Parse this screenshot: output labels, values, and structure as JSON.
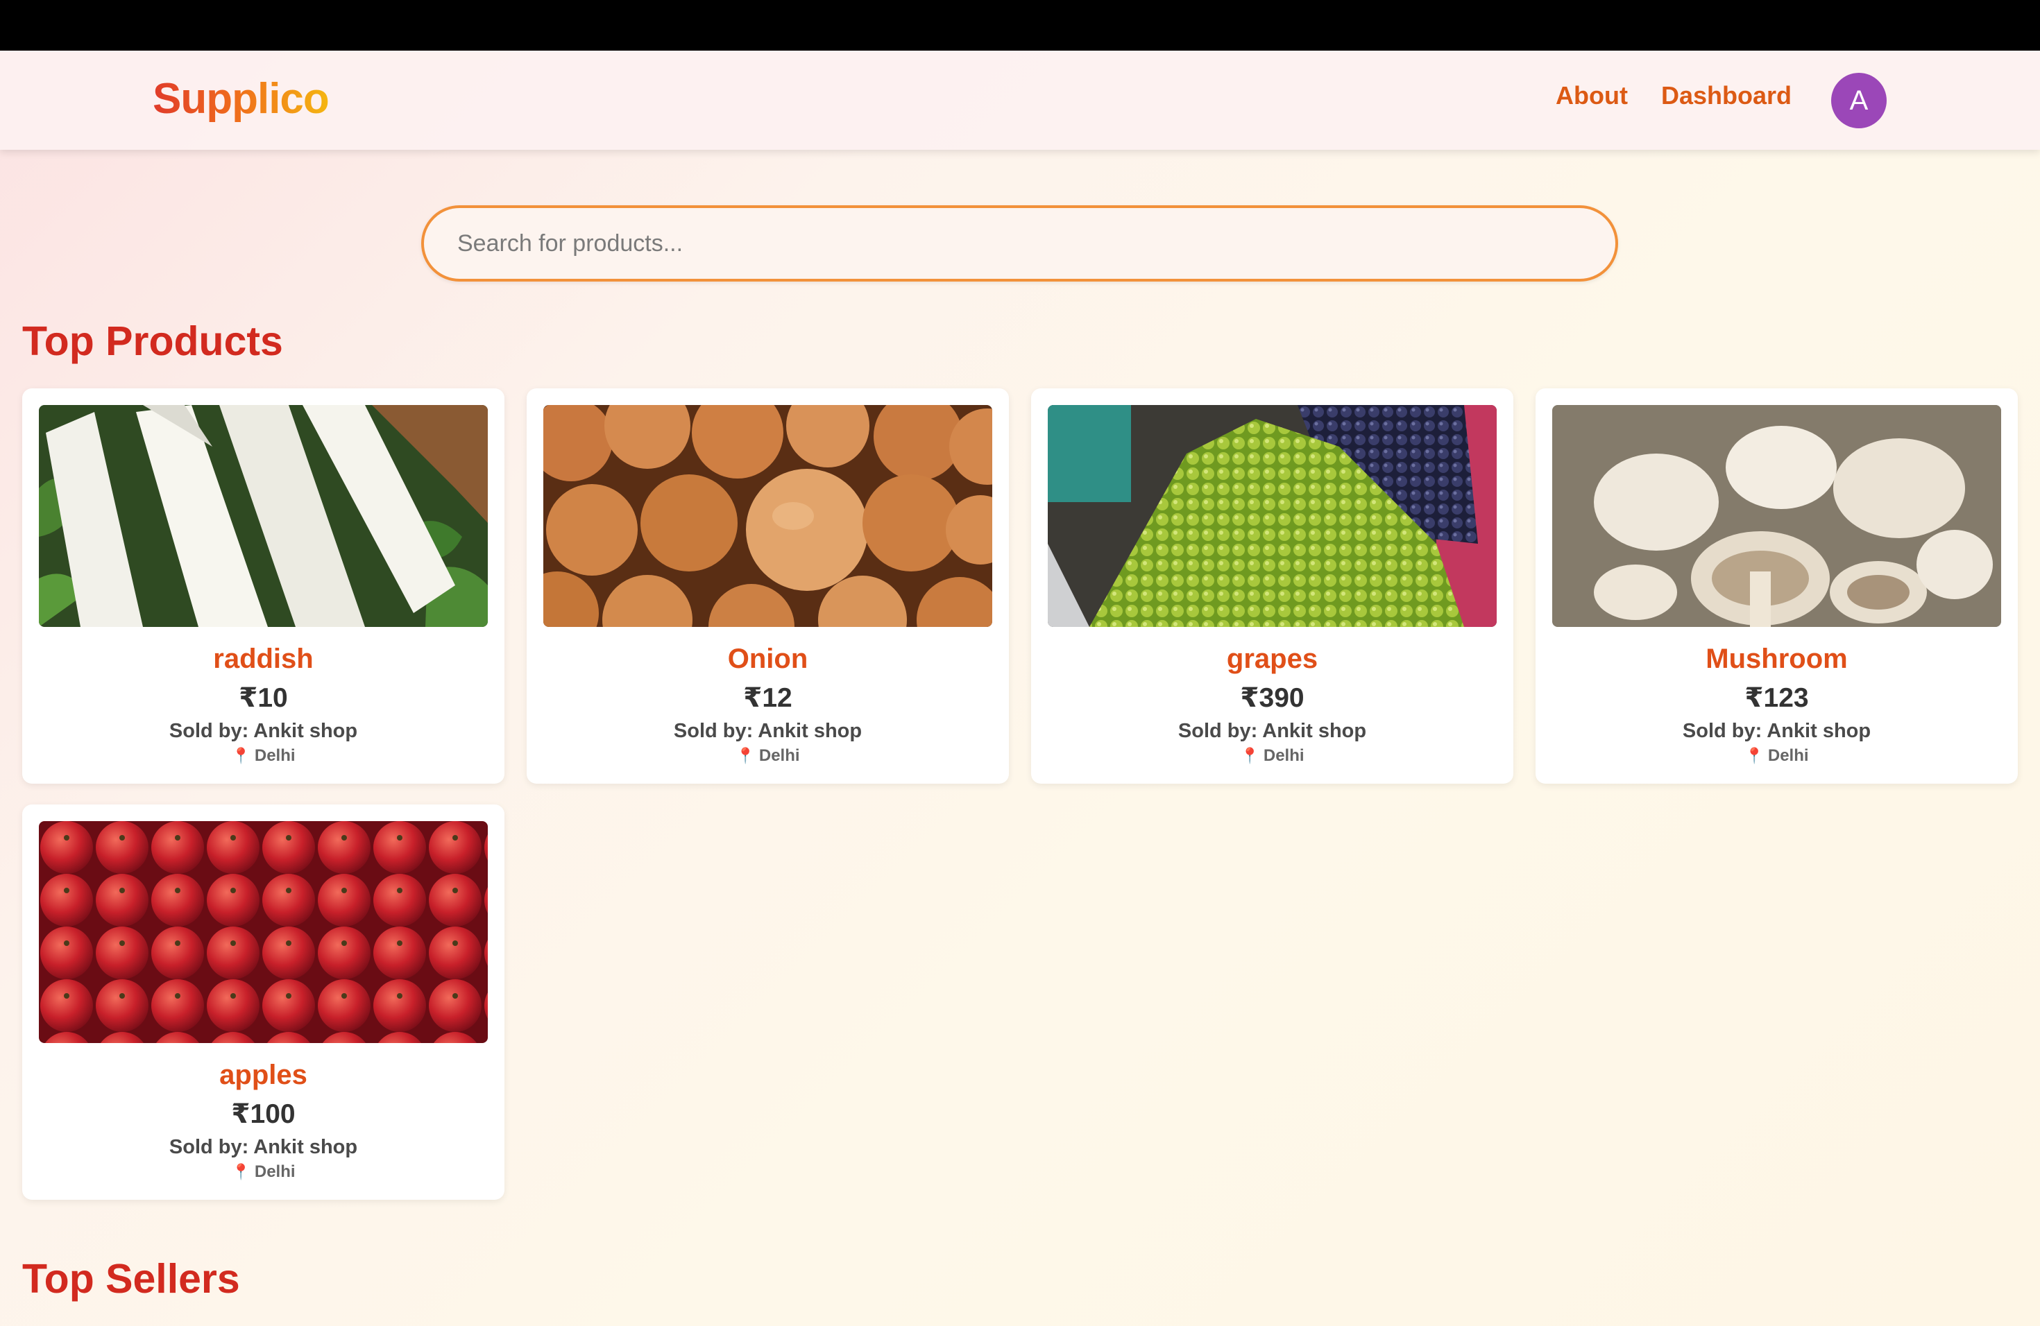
{
  "app": {
    "logo": "Supplico"
  },
  "nav": {
    "about": "About",
    "dashboard": "Dashboard",
    "avatar_initial": "A"
  },
  "search": {
    "placeholder": "Search for products..."
  },
  "sections": {
    "top_products": "Top Products",
    "top_sellers": "Top Sellers"
  },
  "products": [
    {
      "name": "raddish",
      "price": "₹10",
      "seller": "Sold by: Ankit shop",
      "location": "Delhi",
      "image": "radish"
    },
    {
      "name": "Onion",
      "price": "₹12",
      "seller": "Sold by: Ankit shop",
      "location": "Delhi",
      "image": "onion"
    },
    {
      "name": "grapes",
      "price": "₹390",
      "seller": "Sold by: Ankit shop",
      "location": "Delhi",
      "image": "grapes"
    },
    {
      "name": "Mushroom",
      "price": "₹123",
      "seller": "Sold by: Ankit shop",
      "location": "Delhi",
      "image": "mushroom"
    },
    {
      "name": "apples",
      "price": "₹100",
      "seller": "Sold by: Ankit shop",
      "location": "Delhi",
      "image": "apples"
    }
  ],
  "colors": {
    "accent": "#e04f18",
    "title": "#d22a1f",
    "avatar": "#9b47b8",
    "search_border": "#f2913a"
  },
  "icons": {
    "location": "map-pin-icon"
  }
}
